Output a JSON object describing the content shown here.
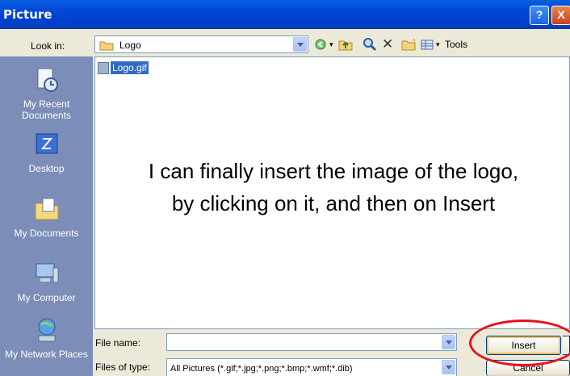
{
  "window": {
    "title": "Picture",
    "help_label": "?",
    "close_label": "X"
  },
  "lookin": {
    "label": "Look in:",
    "value": "Logo"
  },
  "toolbar": {
    "tools_label": "Tools ▾",
    "icons": [
      "back-icon",
      "up-folder-icon",
      "search-web-icon",
      "delete-icon",
      "new-folder-icon",
      "views-icon"
    ]
  },
  "places": [
    {
      "label": "My Recent Documents",
      "icon": "recent-documents-icon"
    },
    {
      "label": "Desktop",
      "icon": "desktop-icon"
    },
    {
      "label": "My Documents",
      "icon": "my-documents-icon"
    },
    {
      "label": "My Computer",
      "icon": "my-computer-icon"
    },
    {
      "label": "My Network Places",
      "icon": "network-places-icon"
    }
  ],
  "files": [
    {
      "name": "Logo.gif",
      "selected": true
    }
  ],
  "annotation": {
    "line1": "I can finally insert the image of the logo,",
    "line2": "by clicking on it, and then on Insert"
  },
  "filename": {
    "label": "File name:",
    "value": ""
  },
  "filetype": {
    "label": "Files of type:",
    "value": "All Pictures (*.gif;*.jpg;*.png;*.bmp;*.wmf;*.dib)"
  },
  "buttons": {
    "insert": "Insert",
    "cancel": "Cancel"
  },
  "colors": {
    "titlebar": "#0046d5",
    "places_bar": "#7c8db8",
    "selection": "#316ac5",
    "highlight_circle": "#e8101a"
  }
}
